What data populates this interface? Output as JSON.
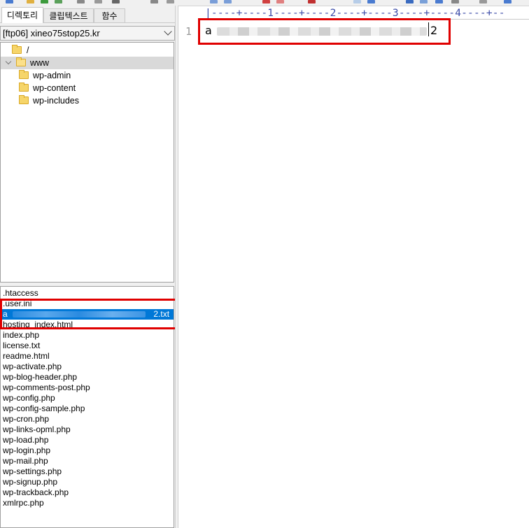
{
  "left_panel": {
    "tabs": [
      "디렉토리",
      "클립텍스트",
      "함수"
    ],
    "active_tab": 0,
    "server_select": {
      "value": "[ftp06] xineo75stop25.kr"
    },
    "tree": [
      {
        "label": "/",
        "depth": 0,
        "expanded": false
      },
      {
        "label": "www",
        "depth": 0,
        "expanded": true,
        "selected": true
      },
      {
        "label": "wp-admin",
        "depth": 1
      },
      {
        "label": "wp-content",
        "depth": 1
      },
      {
        "label": "wp-includes",
        "depth": 1
      }
    ],
    "files": [
      ".htaccess",
      ".user.ini",
      {
        "name_start": "a",
        "name_end": "2.txt",
        "selected": true,
        "obscured": true
      },
      "hosting_index.html",
      "index.php",
      "license.txt",
      "readme.html",
      "wp-activate.php",
      "wp-blog-header.php",
      "wp-comments-post.php",
      "wp-config.php",
      "wp-config-sample.php",
      "wp-cron.php",
      "wp-links-opml.php",
      "wp-load.php",
      "wp-login.php",
      "wp-mail.php",
      "wp-settings.php",
      "wp-signup.php",
      "wp-trackback.php",
      "xmlrpc.php"
    ]
  },
  "editor": {
    "ruler": "|----+----1----+----2----+----3----+----4----+--",
    "line_number": "1",
    "line_text_start": "a",
    "line_text_end": "2"
  },
  "colors": {
    "highlight_red": "#e00000",
    "selection_blue": "#0078d7",
    "ruler_blue": "#3b4ba8"
  },
  "icons": [
    "folder-icon",
    "chevron-down-icon",
    "chevron-right-icon"
  ]
}
